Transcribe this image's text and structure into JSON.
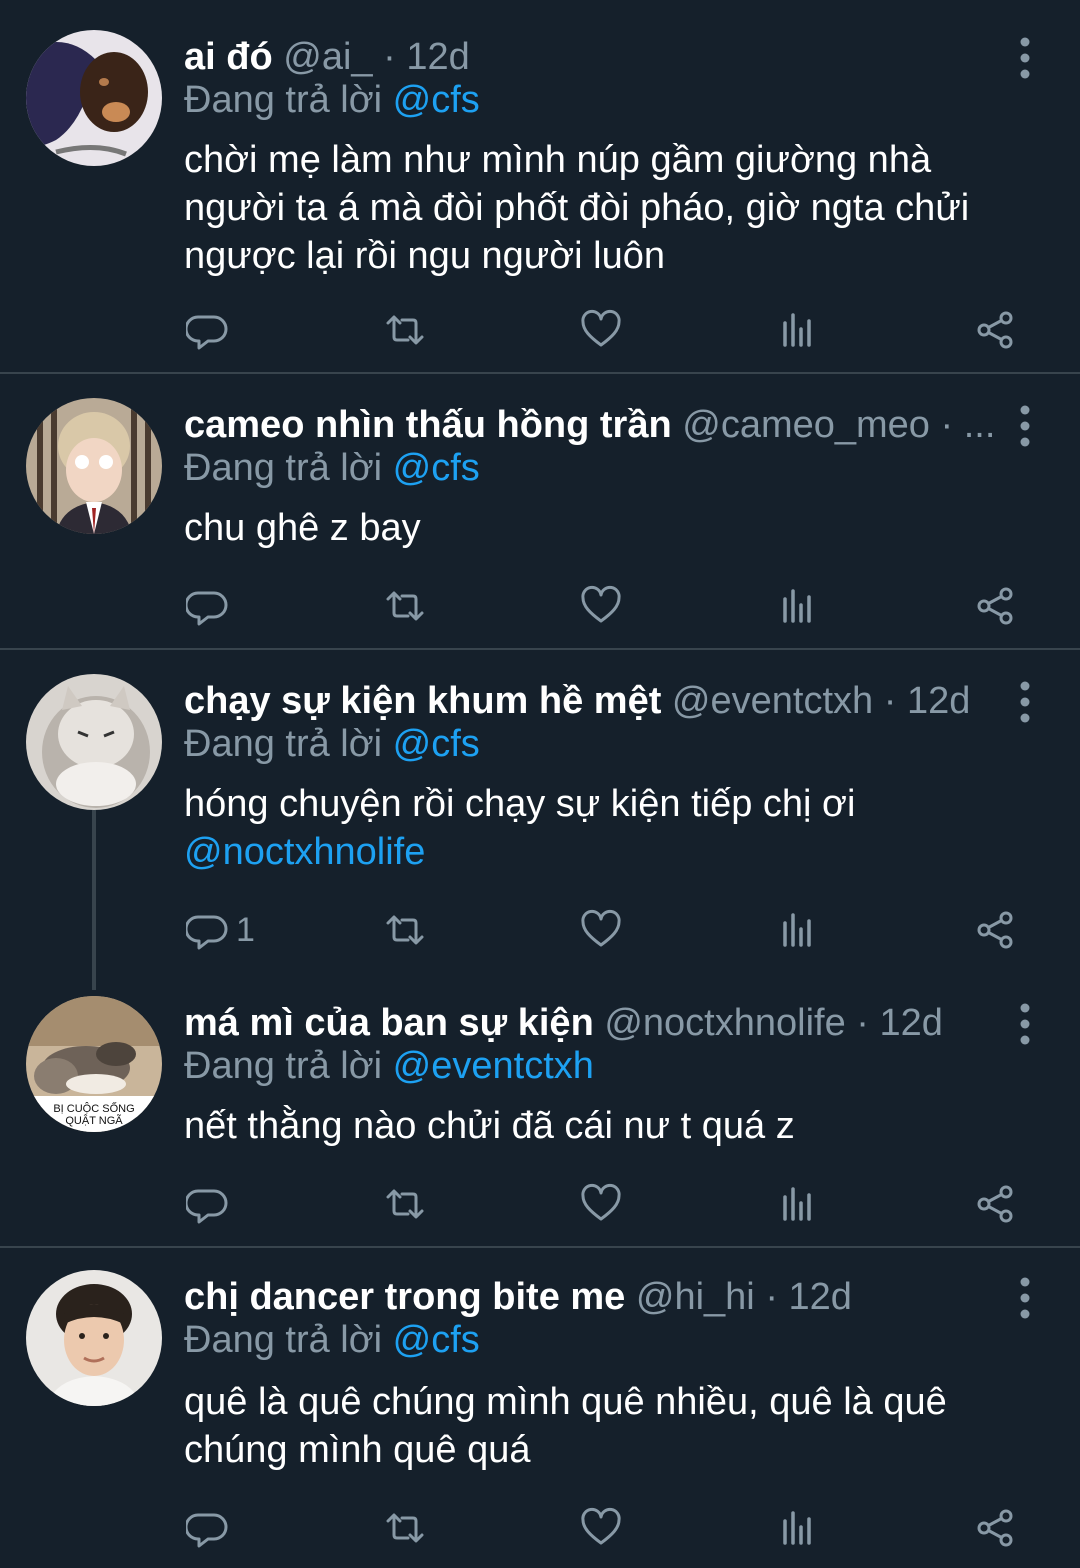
{
  "colors": {
    "background": "#15202b",
    "text": "#ffffff",
    "muted": "#8899a6",
    "link": "#1da1f2",
    "divider": "#38444d"
  },
  "tweets": [
    {
      "name": "ai đó",
      "handle": "@ai_",
      "sep": "·",
      "time": "12d",
      "reply_prefix": "Đang trả lời ",
      "reply_to": "@cfs",
      "lines": [
        "chời mẹ làm như mình núp gầm giường nhà",
        "người ta á mà đòi phốt đòi pháo, giờ ngta chửi",
        "ngược lại rồi ngu người luôn"
      ],
      "reply_count": ""
    },
    {
      "name": "cameo nhìn thấu hồng trần",
      "handle": "@cameo_meo",
      "sep": "· ...",
      "time": "",
      "reply_prefix": "Đang trả lời ",
      "reply_to": "@cfs",
      "lines": [
        "chu ghê z bay"
      ],
      "reply_count": ""
    },
    {
      "name": "chạy sự kiện khum hề mệt",
      "handle": "@eventctxh",
      "sep": "·",
      "time": "12d",
      "reply_prefix": "Đang trả lời ",
      "reply_to": "@cfs",
      "lines": [
        "hóng chuyện rồi chạy sự kiện tiếp chị ơi"
      ],
      "mention_line": "@noctxhnolife",
      "reply_count": "1"
    },
    {
      "name": "má mì của ban sự kiện",
      "handle": "@noctxhnolife",
      "sep": "·",
      "time": "12d",
      "reply_prefix": "Đang trả lời ",
      "reply_to": "@eventctxh",
      "lines": [
        "nết thằng nào chửi đã cái nư t quá z"
      ],
      "reply_count": "",
      "avatar_caption": [
        "BỊ CUỘC SỐNG",
        "QUẬT NGÃ"
      ]
    },
    {
      "name": "chị dancer trong bite me",
      "handle": "@hi_hi",
      "sep": "·",
      "time": "12d",
      "reply_prefix": "Đang trả lời ",
      "reply_to": "@cfs",
      "lines": [
        "quê là quê chúng mình quê nhiều, quê là quê",
        "chúng mình quê quá"
      ],
      "reply_count": ""
    }
  ],
  "icons": {
    "reply": "reply-icon",
    "retweet": "retweet-icon",
    "like": "heart-icon",
    "analytics": "analytics-icon",
    "share": "share-icon",
    "more": "more-vertical-icon"
  }
}
